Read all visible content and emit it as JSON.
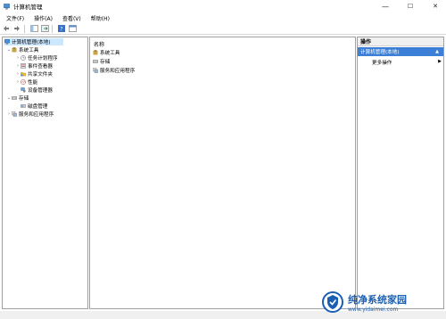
{
  "window": {
    "title": "计算机管理",
    "controls": [
      "—",
      "☐",
      "✕"
    ]
  },
  "menu": [
    "文件(F)",
    "操作(A)",
    "查看(V)",
    "帮助(H)"
  ],
  "tree": {
    "root": "计算机管理(本地)",
    "system_tools": "系统工具",
    "task_scheduler": "任务计划程序",
    "event_viewer": "事件查看器",
    "shared_folders": "共享文件夹",
    "performance": "性能",
    "device_manager": "设备管理器",
    "storage": "存储",
    "disk_management": "磁盘管理",
    "services_apps": "服务和应用程序"
  },
  "middle": {
    "column_name": "名称",
    "items": [
      "系统工具",
      "存储",
      "服务和应用程序"
    ]
  },
  "actions": {
    "header": "操作",
    "section": "计算机管理(本地)",
    "more": "更多操作"
  },
  "watermark": {
    "brand": "纯净系统家园",
    "url": "www.yidaimei.com"
  },
  "colors": {
    "selection": "#cce8ff",
    "action_section": "#3c7fd6",
    "watermark": "#1a5fb4"
  }
}
